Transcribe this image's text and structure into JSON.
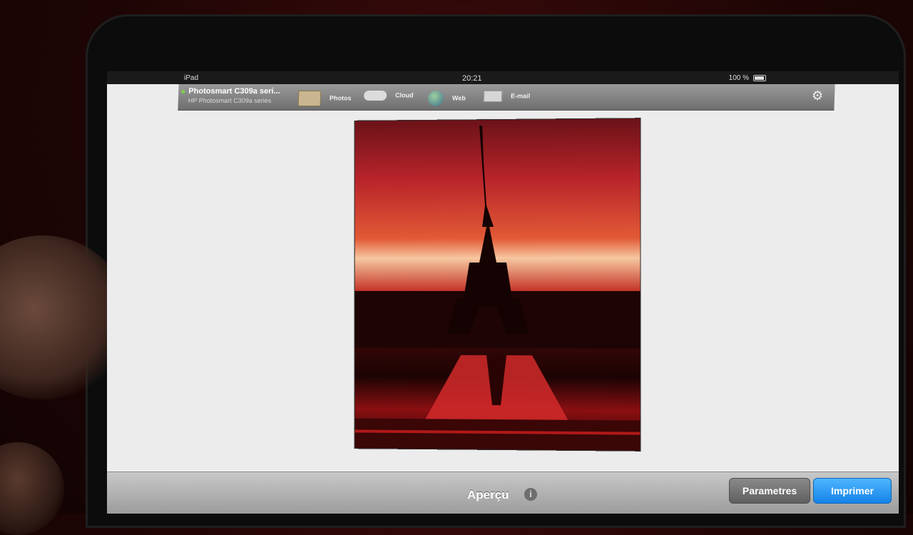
{
  "status_bar": {
    "device_label": "iPad",
    "time": "20:21",
    "battery": "100 %"
  },
  "toolbar": {
    "printer_name": "Photosmart C309a seri...",
    "printer_subtitle": "HP Photosmart C309a series",
    "tabs": [
      {
        "label": "Photos",
        "icon": "photos-icon"
      },
      {
        "label": "Cloud",
        "icon": "cloud-icon"
      },
      {
        "label": "Web",
        "icon": "globe-icon"
      },
      {
        "label": "E-mail",
        "icon": "mail-icon"
      }
    ],
    "settings_icon": "gear-icon"
  },
  "preview": {
    "image_subject": "Eiffel Tower at red sunset"
  },
  "bottom_bar": {
    "title": "Aperçu",
    "info_glyph": "i",
    "parameters_label": "Parametres",
    "print_label": "Imprimer"
  },
  "colors": {
    "print_button": "#1e8ef0",
    "toolbar": "#7d7d7d",
    "screen_background": "#ececec"
  }
}
